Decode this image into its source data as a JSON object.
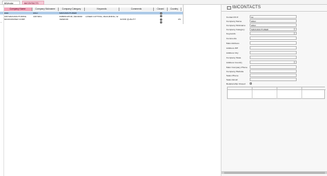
{
  "tabs": [
    {
      "label": "tblVendor"
    },
    {
      "label": "tblCONTACTS"
    }
  ],
  "grid": {
    "columns": [
      "Company Name",
      "Company Nickname",
      "Company Category",
      "Keywords",
      "Comments",
      "Closed",
      "Country"
    ],
    "rows": [
      {
        "name": "H&H",
        "nickname": "HGH",
        "category": "MANUFACTURER",
        "keywords": "",
        "comments": "",
        "closed": false,
        "country": ""
      },
      {
        "name": "JLB MANUFACTURING",
        "nickname": "JLB MFG",
        "category": "FABRICATOR, VENDOR",
        "keywords": "LASER CUTTING, MACHINING, W",
        "comments": "",
        "closed": false,
        "country": ""
      },
      {
        "name": "MICROWATER CORP.",
        "nickname": "",
        "category": "VENDOR",
        "keywords": "",
        "comments": "GOOD QUALITY",
        "closed": false,
        "country": "US"
      }
    ],
    "new_row": "*"
  },
  "form": {
    "title": "tblCONTACTS",
    "fields": [
      {
        "label": "Contact ID #",
        "value": "11"
      },
      {
        "label": "Company Name",
        "value": "HGH"
      },
      {
        "label": "Company Nickname",
        "value": "HGH"
      },
      {
        "label": "Company Category",
        "value": "MANUFACTURER"
      },
      {
        "label": "Keywords",
        "value": ""
      },
      {
        "label": "Comments",
        "value": ""
      },
      {
        "label": "Main Address",
        "value": ""
      },
      {
        "label": "Address ZIP",
        "value": ""
      },
      {
        "label": "Address City",
        "value": ""
      },
      {
        "label": "Company State",
        "value": ""
      },
      {
        "label": "Address Country",
        "value": ""
      },
      {
        "label": "Main Company Phone",
        "value": ""
      },
      {
        "label": "Company Website",
        "value": ""
      },
      {
        "label": "Sales Phone",
        "value": ""
      },
      {
        "label": "Sales Email",
        "value": ""
      }
    ],
    "closed_label": "Relationship Closed",
    "closed_checked": false
  }
}
